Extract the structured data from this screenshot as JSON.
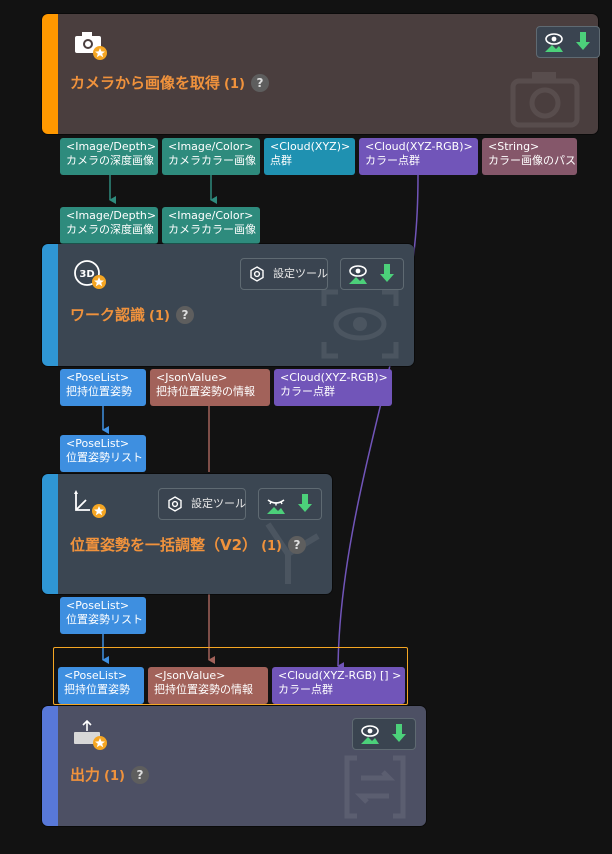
{
  "nodes": {
    "capture": {
      "title": "カメラから画像を取得",
      "count": "(1)",
      "help": "?",
      "icon": "camera-icon",
      "accent": "#ff9800",
      "bg": "#4a3e3e",
      "outputs": [
        {
          "type": "<Image/Depth>",
          "name": "カメラの深度画像"
        },
        {
          "type": "<Image/Color>",
          "name": "カメラカラー画像"
        },
        {
          "type": "<Cloud(XYZ)>",
          "name": "点群"
        },
        {
          "type": "<Cloud(XYZ-RGB)>",
          "name": "カラー点群"
        },
        {
          "type": "<String>",
          "name": "カラー画像のパス"
        }
      ]
    },
    "recognition": {
      "title": "ワーク認識",
      "count": "(1)",
      "help": "?",
      "icon": "3d-icon",
      "accent": "#2f96d4",
      "bg": "#3b4652",
      "tool_label": "設定ツール",
      "inputs": [
        {
          "type": "<Image/Depth>",
          "name": "カメラの深度画像"
        },
        {
          "type": "<Image/Color>",
          "name": "カメラカラー画像"
        }
      ],
      "outputs": [
        {
          "type": "<PoseList>",
          "name": "把持位置姿勢"
        },
        {
          "type": "<JsonValue>",
          "name": "把持位置姿勢の情報"
        },
        {
          "type": "<Cloud(XYZ-RGB)>",
          "name": "カラー点群"
        }
      ]
    },
    "adjust": {
      "title": "位置姿勢を一括調整（V2）",
      "count": "(1)",
      "help": "?",
      "icon": "axis-icon",
      "accent": "#2f96d4",
      "bg": "#3b4652",
      "tool_label": "設定ツール",
      "inputs": [
        {
          "type": "<PoseList>",
          "name": "位置姿勢リスト"
        }
      ],
      "outputs": [
        {
          "type": "<PoseList>",
          "name": "位置姿勢リスト"
        }
      ]
    },
    "output": {
      "title": "出力",
      "count": "(1)",
      "help": "?",
      "icon": "output-icon",
      "accent": "#5878d8",
      "bg": "#4d5064",
      "highlight": "#f5a623",
      "inputs": [
        {
          "type": "<PoseList>",
          "name": "把持位置姿勢"
        },
        {
          "type": "<JsonValue>",
          "name": "把持位置姿勢の情報"
        },
        {
          "type": "<Cloud(XYZ-RGB) [] >",
          "name": "カラー点群"
        }
      ]
    }
  },
  "colors": {
    "image": "#2e8b7d",
    "cloud_xyz": "#1f91b1",
    "cloud_rgb": "#7155b9",
    "string": "#85576a",
    "poselist": "#3e8fe0",
    "json": "#a2625a"
  }
}
